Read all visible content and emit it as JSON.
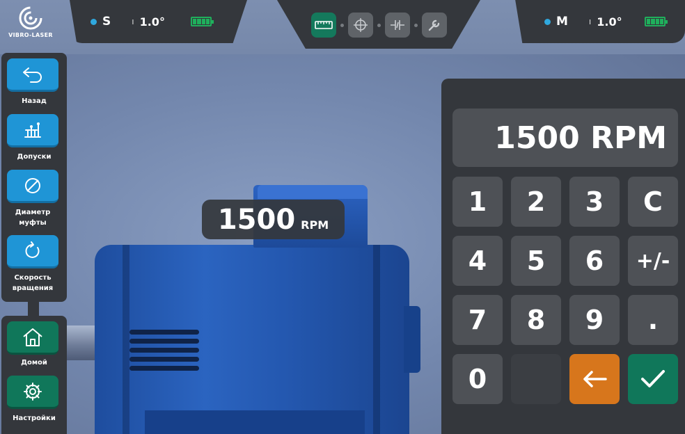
{
  "brand": {
    "name": "VIBRO-LASER"
  },
  "sensors": {
    "left": {
      "name": "S",
      "angle": "1.0°",
      "dot_color": "#2fa8de",
      "battery": "full"
    },
    "right": {
      "name": "M",
      "angle": "1.0°",
      "dot_color": "#2fa8de",
      "battery": "full"
    }
  },
  "modes": [
    {
      "icon": "ruler-icon",
      "active": true
    },
    {
      "icon": "target-icon",
      "active": false
    },
    {
      "icon": "coupling-icon",
      "active": false
    },
    {
      "icon": "wrench-icon",
      "active": false
    }
  ],
  "sidebar": {
    "items": [
      {
        "label": "Назад",
        "icon": "back-arrow-icon",
        "color": "#1f95d6"
      },
      {
        "label": "Допуски",
        "icon": "tolerance-icon",
        "color": "#1f95d6"
      },
      {
        "label": "Диаметр муфты",
        "icon": "diameter-icon",
        "color": "#1f95d6"
      },
      {
        "label": "Скорость вращения",
        "icon": "rotation-icon",
        "color": "#1f95d6"
      }
    ],
    "bottom_items": [
      {
        "label": "Домой",
        "icon": "home-icon",
        "color": "#10775a"
      },
      {
        "label": "Настройки",
        "icon": "gear-icon",
        "color": "#10775a"
      }
    ]
  },
  "scene": {
    "rpm_value": "1500",
    "rpm_unit": "RPM"
  },
  "keypad": {
    "display": "1500 RPM",
    "keys": [
      "1",
      "2",
      "3",
      "C",
      "4",
      "5",
      "6",
      "+/-",
      "7",
      "8",
      "9",
      ".",
      "0",
      ""
    ],
    "backspace_color": "#d7761c",
    "confirm_color": "#10775a"
  }
}
